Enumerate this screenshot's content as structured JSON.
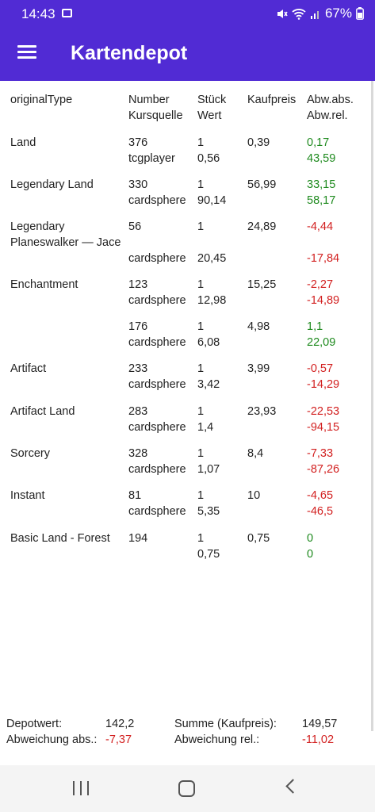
{
  "status": {
    "time": "14:43",
    "battery": "67%",
    "icons": [
      "image-icon",
      "mute-icon",
      "wifi-icon",
      "signal-icon",
      "battery-icon"
    ]
  },
  "appbar": {
    "title": "Kartendepot",
    "menu_icon": "hamburger-menu-icon"
  },
  "table": {
    "header": {
      "c1": "originalType",
      "c2": "Number\nKursquelle",
      "c3": "Stück\nWert",
      "c4": "Kaufpreis",
      "c5": "Abw.abs.\nAbw.rel."
    },
    "rows": [
      {
        "type": "Land",
        "number": "376",
        "source": "tcgplayer",
        "count": "1",
        "value": "0,56",
        "price": "0,39",
        "abs": "0,17",
        "rel": "43,59",
        "sign": "pos"
      },
      {
        "type": "Legendary Land",
        "number": "330",
        "source": "cardsphere",
        "count": "1",
        "value": "90,14",
        "price": "56,99",
        "abs": "33,15",
        "rel": "58,17",
        "sign": "pos"
      },
      {
        "type": "Legendary\nPlaneswalker — Jace",
        "number": "56",
        "source": "cardsphere",
        "count": "1",
        "value": "20,45",
        "price": "24,89",
        "abs": "-4,44",
        "rel": "-17,84",
        "sign": "neg"
      },
      {
        "type": "Enchantment",
        "number": "123",
        "source": "cardsphere",
        "count": "1",
        "value": "12,98",
        "price": "15,25",
        "abs": "-2,27",
        "rel": "-14,89",
        "sign": "neg"
      },
      {
        "type": "",
        "number": "176",
        "source": "cardsphere",
        "count": "1",
        "value": "6,08",
        "price": "4,98",
        "abs": "1,1",
        "rel": "22,09",
        "sign": "pos"
      },
      {
        "type": "Artifact",
        "number": "233",
        "source": "cardsphere",
        "count": "1",
        "value": "3,42",
        "price": "3,99",
        "abs": "-0,57",
        "rel": "-14,29",
        "sign": "neg"
      },
      {
        "type": "Artifact Land",
        "number": "283",
        "source": "cardsphere",
        "count": "1",
        "value": "1,4",
        "price": "23,93",
        "abs": "-22,53",
        "rel": "-94,15",
        "sign": "neg"
      },
      {
        "type": "Sorcery",
        "number": "328",
        "source": "cardsphere",
        "count": "1",
        "value": "1,07",
        "price": "8,4",
        "abs": "-7,33",
        "rel": "-87,26",
        "sign": "neg"
      },
      {
        "type": "Instant",
        "number": "81",
        "source": "cardsphere",
        "count": "1",
        "value": "5,35",
        "price": "10",
        "abs": "-4,65",
        "rel": "-46,5",
        "sign": "neg"
      },
      {
        "type": "Basic Land - Forest",
        "number": "194",
        "source": "",
        "count": "1",
        "value": "0,75",
        "price": "0,75",
        "abs": "0",
        "rel": "0",
        "sign": "pos"
      }
    ]
  },
  "footer": {
    "depotwert_label": "Depotwert:",
    "depotwert": "142,2",
    "abw_abs_label": "Abweichung abs.:",
    "abw_abs": "-7,37",
    "summe_label": "Summe (Kaufpreis):",
    "summe": "149,57",
    "abw_rel_label": "Abweichung rel.:",
    "abw_rel": "-11,02"
  },
  "colors": {
    "primary": "#512bd4",
    "negative": "#d21f1f",
    "positive": "#1e8a1e"
  },
  "nav": {
    "icons": [
      "recents-icon",
      "home-icon",
      "back-icon"
    ]
  }
}
